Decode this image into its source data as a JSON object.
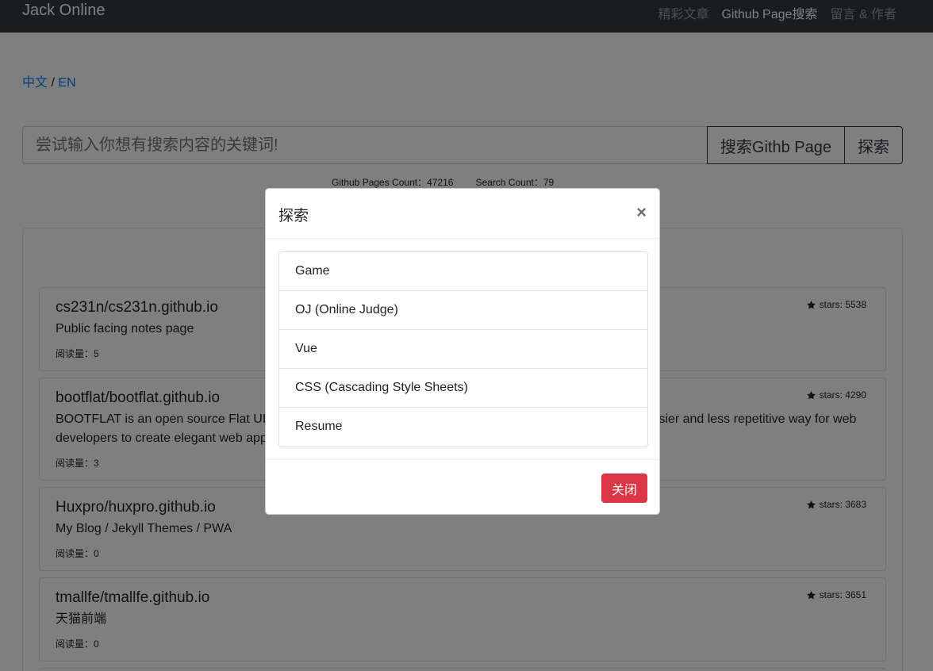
{
  "navbar": {
    "brand": "Jack Online",
    "links": [
      {
        "label": "精彩文章",
        "active": false
      },
      {
        "label": "Github Page搜索",
        "active": true
      },
      {
        "label": "留言 & 作者",
        "active": false
      }
    ]
  },
  "lang": {
    "zh": "中文",
    "separator": " / ",
    "en": "EN"
  },
  "search": {
    "placeholder": "尝试输入你想有搜索内容的关键词!",
    "search_button": "搜索Githb Page",
    "explore_button": "探索"
  },
  "counts": {
    "pages": "Github Pages Count：47216",
    "searches": "Search Count：79"
  },
  "results": [
    {
      "title": "cs231n/cs231n.github.io",
      "desc": "Public facing notes page",
      "reads": "阅读量：5",
      "stars": "stars: 5538"
    },
    {
      "title": "bootflat/bootflat.github.io",
      "desc": "BOOTFLAT is an open source Flat UI KIT based on Bootstrap 3.3.0 CSS framework. It provides a faster, easier and less repetitive way for web developers to create elegant web apps.",
      "reads": "阅读量：3",
      "stars": "stars: 4290"
    },
    {
      "title": "Huxpro/huxpro.github.io",
      "desc": "My Blog / Jekyll Themes / PWA",
      "reads": "阅读量：0",
      "stars": "stars: 3683"
    },
    {
      "title": "tmallfe/tmallfe.github.io",
      "desc": "天猫前端",
      "reads": "阅读量：0",
      "stars": "stars: 3651"
    }
  ],
  "modal": {
    "title": "探索",
    "close_symbol": "×",
    "items": [
      "Game",
      "OJ (Online Judge)",
      "Vue",
      "CSS (Cascading Style Sheets)",
      "Resume"
    ],
    "footer_button": "关闭"
  },
  "colors": {
    "navbar_bg": "#343a40",
    "link": "#007bff",
    "danger": "#dc3545"
  }
}
